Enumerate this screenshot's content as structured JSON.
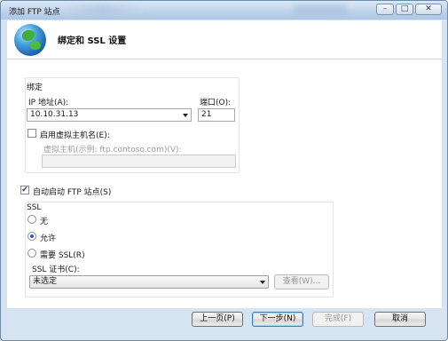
{
  "window": {
    "title": "添加 FTP 站点",
    "controls": {
      "minimize": "–",
      "maximize": "□",
      "close": "✕"
    }
  },
  "header": {
    "icon": "globe-icon",
    "title": "绑定和 SSL 设置"
  },
  "binding": {
    "group_title": "绑定",
    "ip_label": "IP 地址(A):",
    "ip_value": "10.10.31.13",
    "port_label": "端口(O):",
    "port_value": "21",
    "virtual_host_checkbox_label": "启用虚拟主机名(E):",
    "virtual_host_checked": false,
    "virtual_host_label": "虚拟主机(示例: ftp.contoso.com)(V):",
    "virtual_host_value": ""
  },
  "autostart": {
    "label": "自动启动 FTP 站点(S)",
    "checked": true
  },
  "ssl": {
    "group_title": "SSL",
    "options": [
      {
        "label": "无",
        "selected": false
      },
      {
        "label": "允许",
        "selected": true
      },
      {
        "label": "需要 SSL(R)",
        "selected": false
      }
    ],
    "cert_label": "SSL 证书(C):",
    "cert_value": "未选定",
    "view_button": "查看(W)..."
  },
  "footer": {
    "prev": "上一页(P)",
    "next": "下一步(N)",
    "finish": "完成(F)",
    "cancel": "取消"
  }
}
